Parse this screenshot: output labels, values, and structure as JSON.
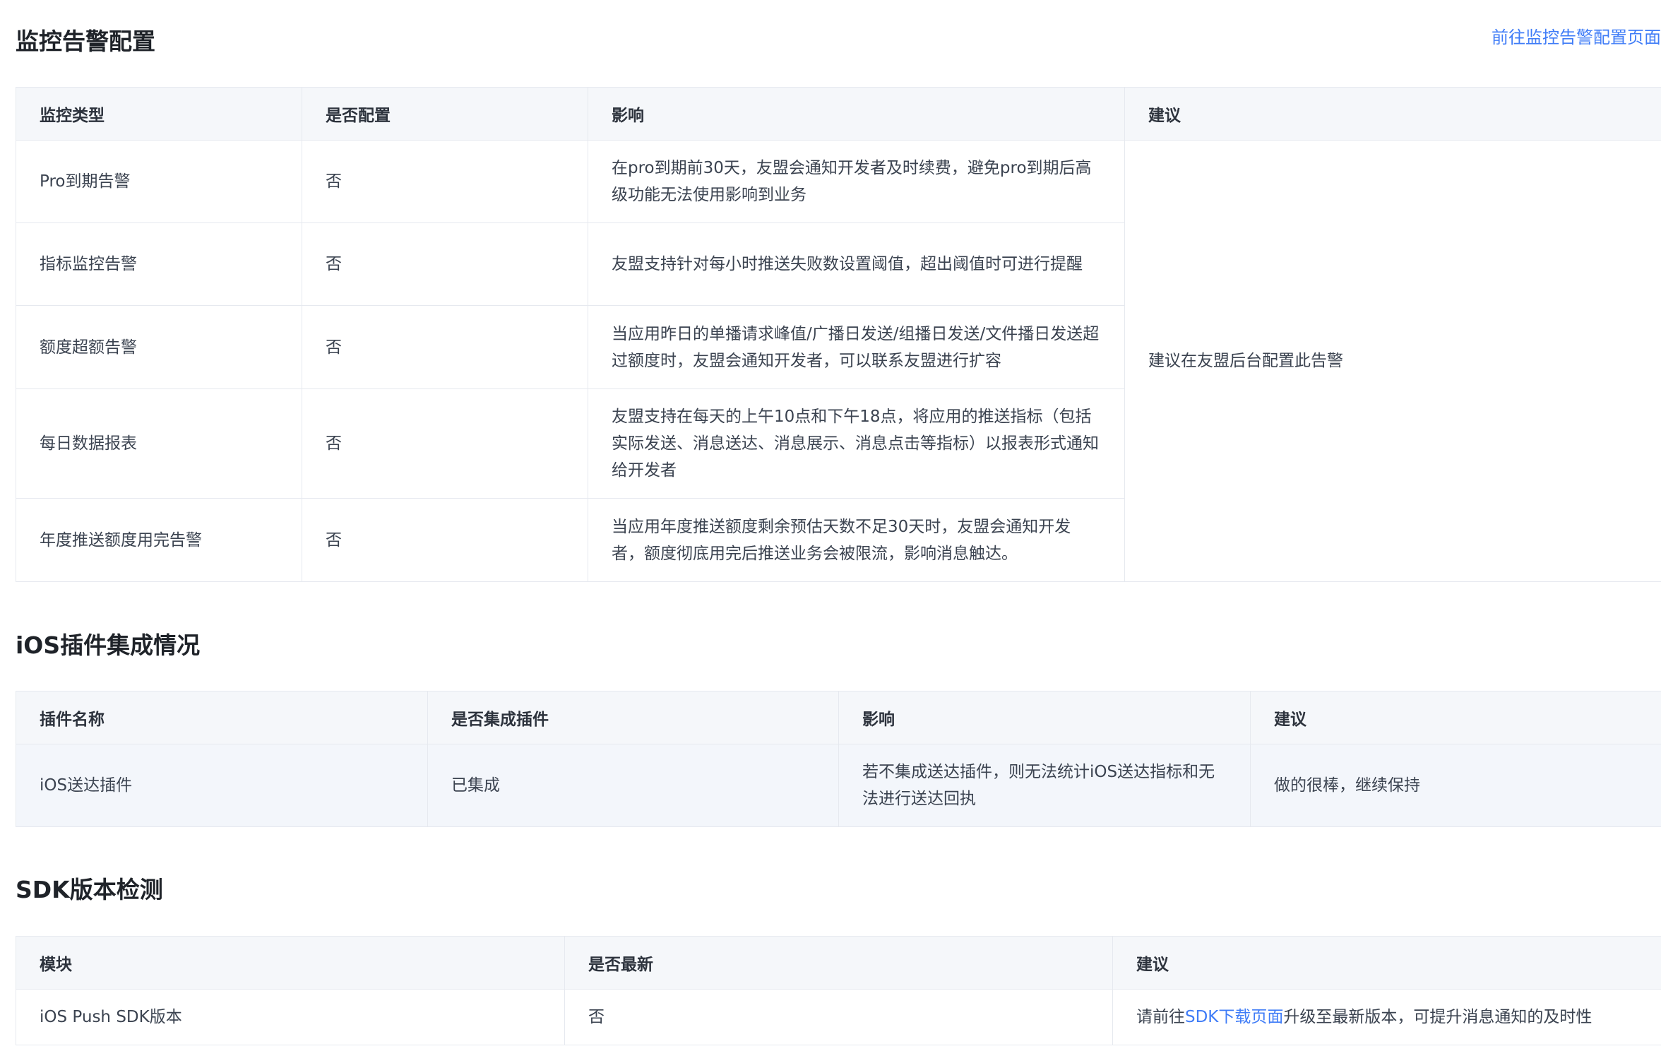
{
  "monitoring": {
    "title": "监控告警配置",
    "link": "前往监控告警配置页面",
    "headers": [
      "监控类型",
      "是否配置",
      "影响",
      "建议"
    ],
    "suggestion": "建议在友盟后台配置此告警",
    "rows": [
      {
        "type": "Pro到期告警",
        "configured": "否",
        "impact": "在pro到期前30天，友盟会通知开发者及时续费，避免pro到期后高级功能无法使用影响到业务"
      },
      {
        "type": "指标监控告警",
        "configured": "否",
        "impact": "友盟支持针对每小时推送失败数设置阈值，超出阈值时可进行提醒"
      },
      {
        "type": "额度超额告警",
        "configured": "否",
        "impact": "当应用昨日的单播请求峰值/广播日发送/组播日发送/文件播日发送超过额度时，友盟会通知开发者，可以联系友盟进行扩容"
      },
      {
        "type": "每日数据报表",
        "configured": "否",
        "impact": "友盟支持在每天的上午10点和下午18点，将应用的推送指标（包括实际发送、消息送达、消息展示、消息点击等指标）以报表形式通知给开发者"
      },
      {
        "type": "年度推送额度用完告警",
        "configured": "否",
        "impact": "当应用年度推送额度剩余预估天数不足30天时，友盟会通知开发者，额度彻底用完后推送业务会被限流，影响消息触达。"
      }
    ]
  },
  "ios_plugin": {
    "title": "iOS插件集成情况",
    "headers": [
      "插件名称",
      "是否集成插件",
      "影响",
      "建议"
    ],
    "rows": [
      {
        "name": "iOS送达插件",
        "integrated": "已集成",
        "impact": "若不集成送达插件，则无法统计iOS送达指标和无法进行送达回执",
        "suggestion": "做的很棒，继续保持"
      }
    ]
  },
  "sdk": {
    "title": "SDK版本检测",
    "headers": [
      "模块",
      "是否最新",
      "建议"
    ],
    "rows": [
      {
        "module": "iOS Push SDK版本",
        "latest": "否",
        "suggestion_prefix": "请前往",
        "suggestion_link": "SDK下载页面",
        "suggestion_suffix": "升级至最新版本，可提升消息通知的及时性"
      }
    ]
  }
}
